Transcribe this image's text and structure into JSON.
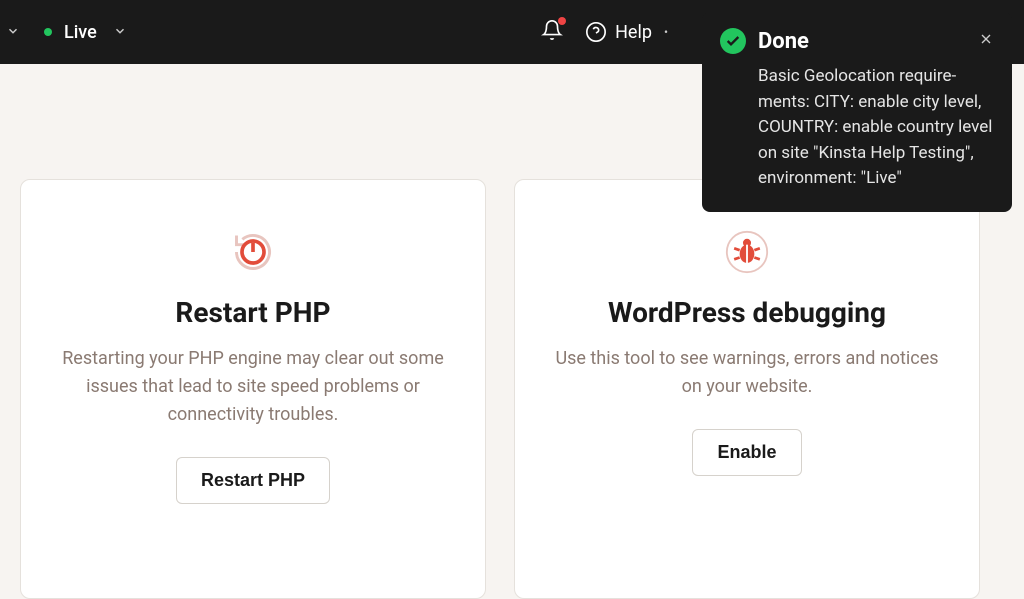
{
  "topbar": {
    "env_label": "Live",
    "help_label": "Help"
  },
  "toast": {
    "title": "Done",
    "body": "Basic Geolocation require­ments: CITY: enable city level, COUNTRY: enable country level on site \"Kinsta Help Testing\", environment: \"Live\""
  },
  "cards": {
    "restart": {
      "title": "Restart PHP",
      "desc": "Restarting your PHP engine may clear out some issues that lead to site speed problems or connectivity troubles.",
      "button": "Restart PHP"
    },
    "debug": {
      "title": "WordPress debugging",
      "desc": "Use this tool to see warnings, errors and notices on your website.",
      "button": "Enable"
    }
  }
}
